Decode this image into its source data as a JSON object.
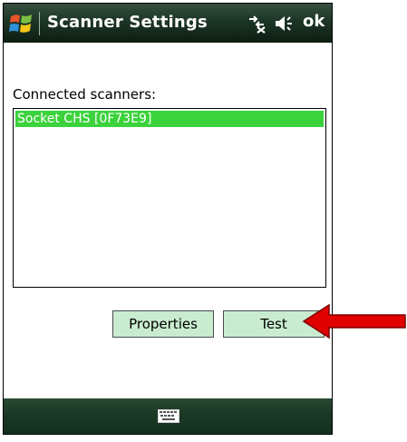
{
  "titlebar": {
    "title": "Scanner Settings",
    "ok_label": "ok",
    "start_icon": "windows-flag-icon",
    "connectivity_icon": "connectivity-icon",
    "volume_icon": "speaker-icon"
  },
  "main": {
    "connected_label": "Connected scanners:",
    "scanners": [
      {
        "label": "Socket CHS [0F73E9]",
        "selected": true
      }
    ],
    "buttons": {
      "properties_label": "Properties",
      "test_label": "Test"
    }
  },
  "bottombar": {
    "keyboard_icon": "keyboard-icon"
  },
  "annotation": {
    "arrow_icon": "red-arrow-icon",
    "arrow_color": "#e00000"
  },
  "colors": {
    "selection": "#3bd23b",
    "button_bg": "#c9ecd0",
    "bar_dark": "#1d3526"
  }
}
